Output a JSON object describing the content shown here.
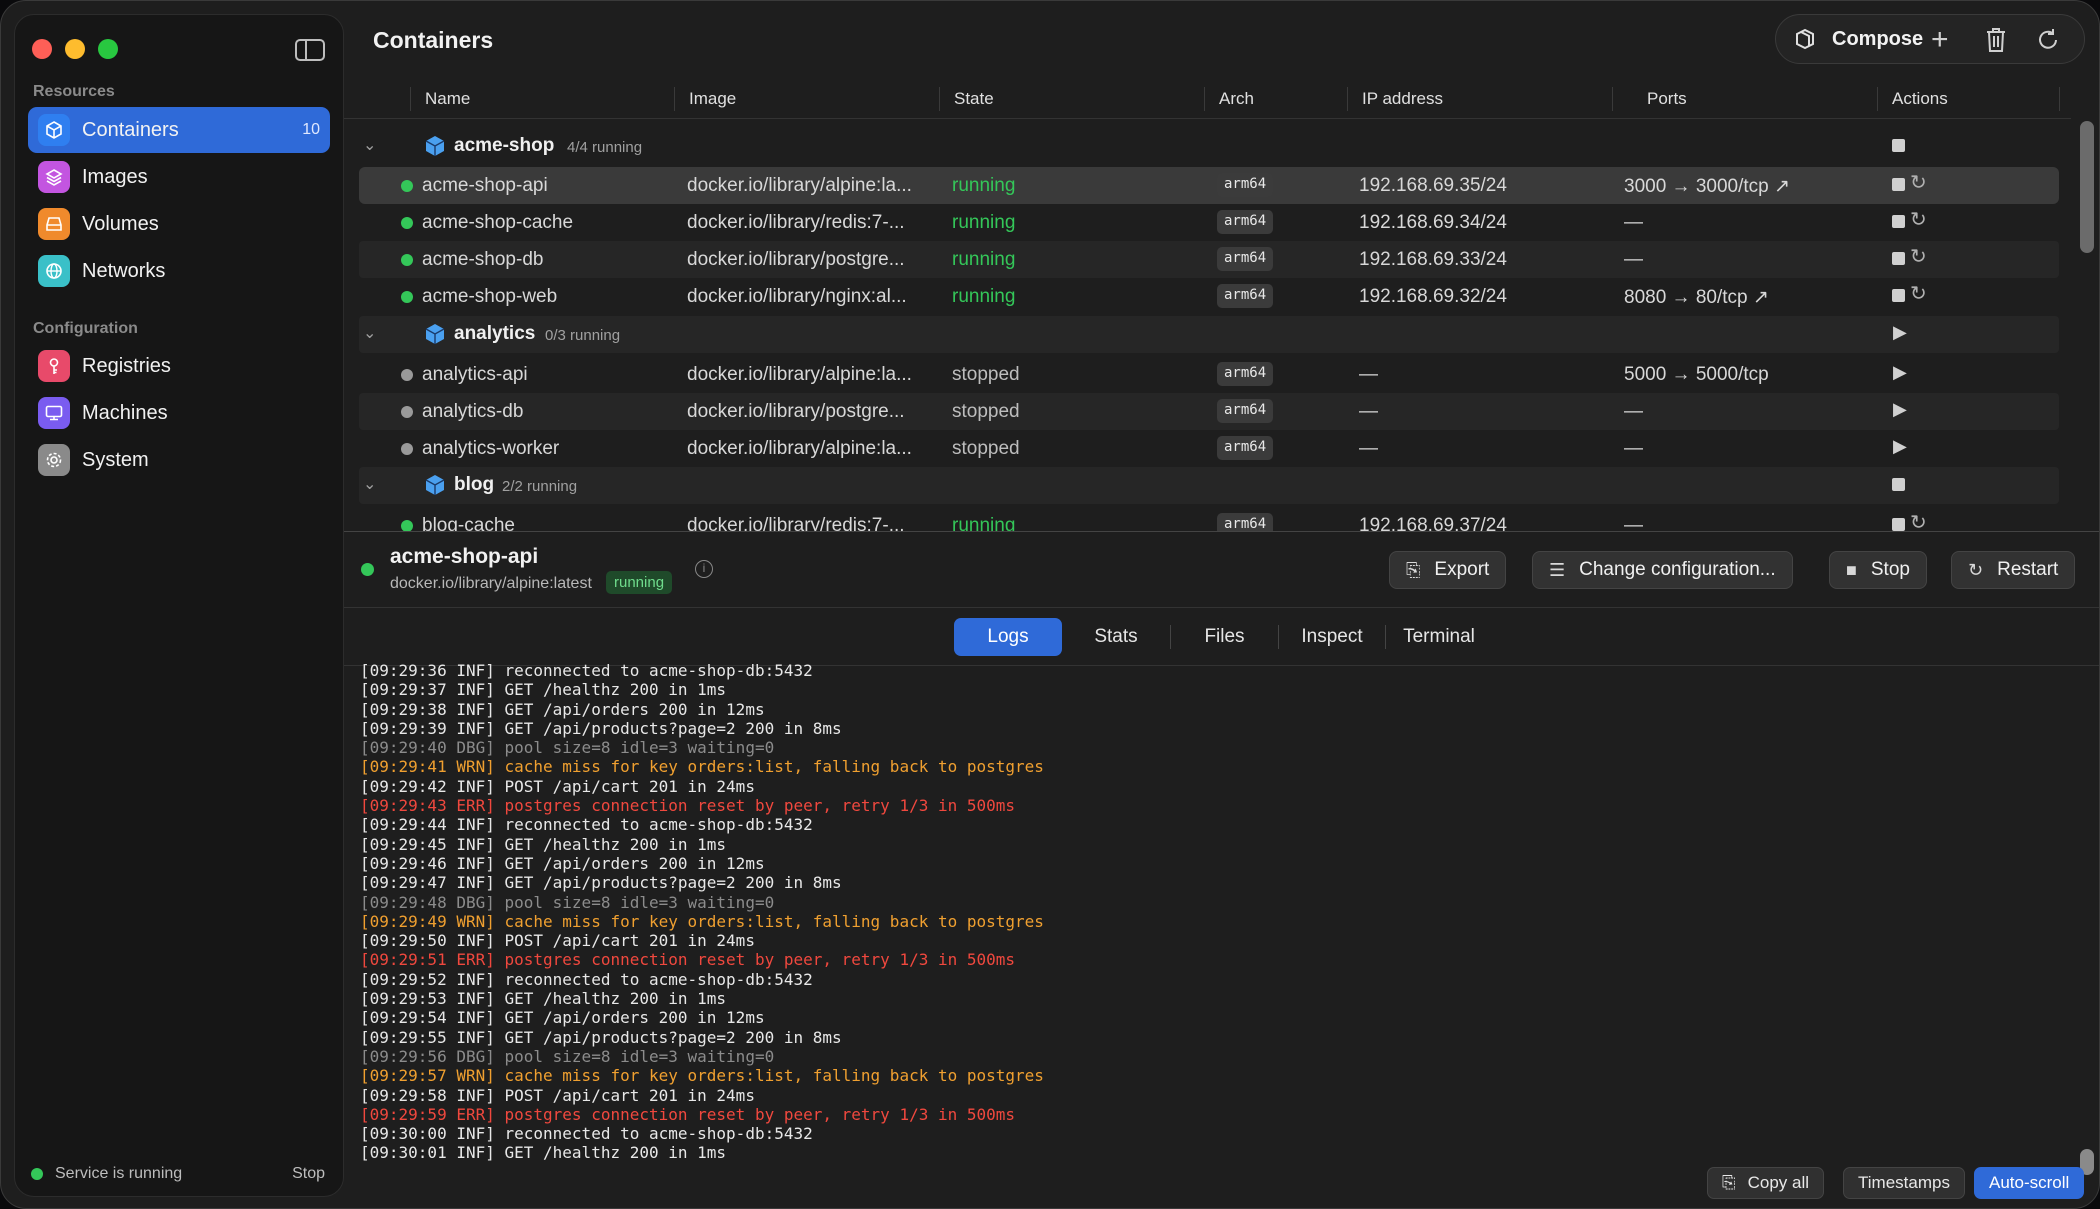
{
  "app": {
    "title": "Containers"
  },
  "sidebar": {
    "sections": [
      {
        "label": "Resources"
      },
      {
        "label": "Configuration"
      }
    ],
    "items": [
      {
        "label": "Containers",
        "count": "10",
        "icon": "cube-icon",
        "color": "#2f7ff0"
      },
      {
        "label": "Images",
        "icon": "layers-icon",
        "color": "#c355e0"
      },
      {
        "label": "Volumes",
        "icon": "drive-icon",
        "color": "#f08a2c"
      },
      {
        "label": "Networks",
        "icon": "globe-icon",
        "color": "#3ac0c8"
      },
      {
        "label": "Registries",
        "icon": "key-icon",
        "color": "#e84a6a"
      },
      {
        "label": "Machines",
        "icon": "monitor-icon",
        "color": "#7a5cf0"
      },
      {
        "label": "System",
        "icon": "gear-icon",
        "color": "#8a8a8a"
      }
    ],
    "service": {
      "status": "Service is running",
      "stop_label": "Stop"
    }
  },
  "toolbar": {
    "compose_label": "Compose"
  },
  "table": {
    "columns": [
      "Name",
      "Image",
      "State",
      "Arch",
      "IP address",
      "Ports",
      "Actions"
    ],
    "groups": [
      {
        "name": "acme-shop",
        "count": "4/4 running",
        "rows": [
          {
            "name": "acme-shop-api",
            "image": "docker.io/library/alpine:la...",
            "state": "running",
            "arch": "arm64",
            "ip": "192.168.69.35/24",
            "ports": "3000 → 3000/tcp ↗"
          },
          {
            "name": "acme-shop-cache",
            "image": "docker.io/library/redis:7-...",
            "state": "running",
            "arch": "arm64",
            "ip": "192.168.69.34/24",
            "ports": "—"
          },
          {
            "name": "acme-shop-db",
            "image": "docker.io/library/postgre...",
            "state": "running",
            "arch": "arm64",
            "ip": "192.168.69.33/24",
            "ports": "—"
          },
          {
            "name": "acme-shop-web",
            "image": "docker.io/library/nginx:al...",
            "state": "running",
            "arch": "arm64",
            "ip": "192.168.69.32/24",
            "ports": "8080 → 80/tcp ↗"
          }
        ]
      },
      {
        "name": "analytics",
        "count": "0/3 running",
        "rows": [
          {
            "name": "analytics-api",
            "image": "docker.io/library/alpine:la...",
            "state": "stopped",
            "arch": "arm64",
            "ip": "—",
            "ports": "5000 → 5000/tcp"
          },
          {
            "name": "analytics-db",
            "image": "docker.io/library/postgre...",
            "state": "stopped",
            "arch": "arm64",
            "ip": "—",
            "ports": "—"
          },
          {
            "name": "analytics-worker",
            "image": "docker.io/library/alpine:la...",
            "state": "stopped",
            "arch": "arm64",
            "ip": "—",
            "ports": "—"
          }
        ]
      },
      {
        "name": "blog",
        "count": "2/2 running",
        "rows": [
          {
            "name": "blog-cache",
            "image": "docker.io/library/redis:7-...",
            "state": "running",
            "arch": "arm64",
            "ip": "192.168.69.37/24",
            "ports": "—"
          }
        ]
      }
    ]
  },
  "detail": {
    "name": "acme-shop-api",
    "image": "docker.io/library/alpine:latest",
    "state": "running",
    "buttons": {
      "export": "Export",
      "change_config": "Change configuration...",
      "stop": "Stop",
      "restart": "Restart"
    },
    "tabs": [
      "Logs",
      "Stats",
      "Files",
      "Inspect",
      "Terminal"
    ]
  },
  "logs": [
    {
      "level": "inf",
      "text": "[09:29:36 INF] reconnected to acme-shop-db:5432"
    },
    {
      "level": "inf",
      "text": "[09:29:37 INF] GET /healthz 200 in 1ms"
    },
    {
      "level": "inf",
      "text": "[09:29:38 INF] GET /api/orders 200 in 12ms"
    },
    {
      "level": "inf",
      "text": "[09:29:39 INF] GET /api/products?page=2 200 in 8ms"
    },
    {
      "level": "dbg",
      "text": "[09:29:40 DBG] pool size=8 idle=3 waiting=0"
    },
    {
      "level": "wrn",
      "text": "[09:29:41 WRN] cache miss for key orders:list, falling back to postgres"
    },
    {
      "level": "inf",
      "text": "[09:29:42 INF] POST /api/cart 201 in 24ms"
    },
    {
      "level": "err",
      "text": "[09:29:43 ERR] postgres connection reset by peer, retry 1/3 in 500ms"
    },
    {
      "level": "inf",
      "text": "[09:29:44 INF] reconnected to acme-shop-db:5432"
    },
    {
      "level": "inf",
      "text": "[09:29:45 INF] GET /healthz 200 in 1ms"
    },
    {
      "level": "inf",
      "text": "[09:29:46 INF] GET /api/orders 200 in 12ms"
    },
    {
      "level": "inf",
      "text": "[09:29:47 INF] GET /api/products?page=2 200 in 8ms"
    },
    {
      "level": "dbg",
      "text": "[09:29:48 DBG] pool size=8 idle=3 waiting=0"
    },
    {
      "level": "wrn",
      "text": "[09:29:49 WRN] cache miss for key orders:list, falling back to postgres"
    },
    {
      "level": "inf",
      "text": "[09:29:50 INF] POST /api/cart 201 in 24ms"
    },
    {
      "level": "err",
      "text": "[09:29:51 ERR] postgres connection reset by peer, retry 1/3 in 500ms"
    },
    {
      "level": "inf",
      "text": "[09:29:52 INF] reconnected to acme-shop-db:5432"
    },
    {
      "level": "inf",
      "text": "[09:29:53 INF] GET /healthz 200 in 1ms"
    },
    {
      "level": "inf",
      "text": "[09:29:54 INF] GET /api/orders 200 in 12ms"
    },
    {
      "level": "inf",
      "text": "[09:29:55 INF] GET /api/products?page=2 200 in 8ms"
    },
    {
      "level": "dbg",
      "text": "[09:29:56 DBG] pool size=8 idle=3 waiting=0"
    },
    {
      "level": "wrn",
      "text": "[09:29:57 WRN] cache miss for key orders:list, falling back to postgres"
    },
    {
      "level": "inf",
      "text": "[09:29:58 INF] POST /api/cart 201 in 24ms"
    },
    {
      "level": "err",
      "text": "[09:29:59 ERR] postgres connection reset by peer, retry 1/3 in 500ms"
    },
    {
      "level": "inf",
      "text": "[09:30:00 INF] reconnected to acme-shop-db:5432"
    },
    {
      "level": "inf",
      "text": "[09:30:01 INF] GET /healthz 200 in 1ms"
    }
  ],
  "log_footer": {
    "copy_all": "Copy all",
    "timestamps": "Timestamps",
    "auto_scroll": "Auto-scroll"
  }
}
